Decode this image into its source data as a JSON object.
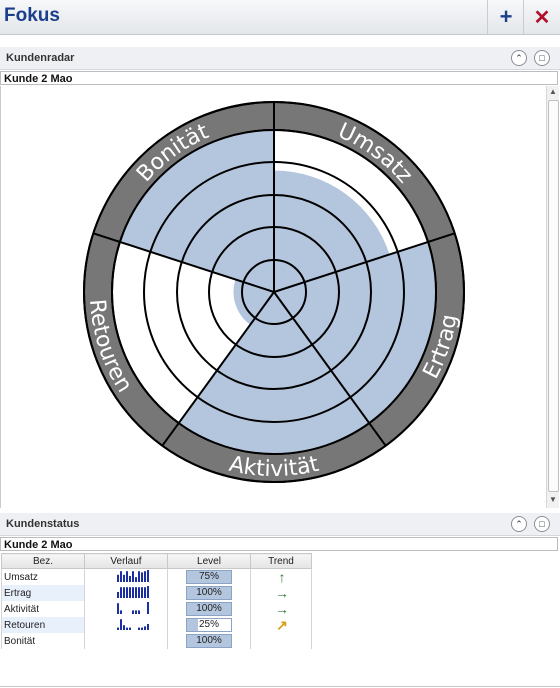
{
  "app": {
    "title": "Fokus",
    "add_label": "+",
    "close_label": "✕"
  },
  "radar_panel": {
    "title": "Kundenradar",
    "subject": "Kunde 2 Mao",
    "segments": [
      {
        "label": "Umsatz",
        "level": 0.75
      },
      {
        "label": "Ertrag",
        "level": 1.0
      },
      {
        "label": "Aktivität",
        "level": 1.0
      },
      {
        "label": "Retouren",
        "level": 0.25
      },
      {
        "label": "Bonität",
        "level": 1.0
      }
    ],
    "colors": {
      "fill": "#b4c6de",
      "ring": "#777777",
      "ring_text": "#ffffff"
    }
  },
  "status_panel": {
    "title": "Kundenstatus",
    "subject": "Kunde 2 Mao",
    "columns": [
      "Bez.",
      "Verlauf",
      "Level",
      "Trend"
    ],
    "rows": [
      {
        "name": "Umsatz",
        "level": "75%",
        "trend": "up",
        "trend_icon": "↑",
        "trend_color": "#2e7d32"
      },
      {
        "name": "Ertrag",
        "level": "100%",
        "trend": "right",
        "trend_icon": "→",
        "trend_color": "#2e7d32"
      },
      {
        "name": "Aktivität",
        "level": "100%",
        "trend": "right",
        "trend_icon": "→",
        "trend_color": "#2e7d32"
      },
      {
        "name": "Retouren",
        "level": "25%",
        "trend": "up-right",
        "trend_icon": "↗",
        "trend_color": "#d4a017"
      },
      {
        "name": "Bonität",
        "level": "100%",
        "trend": "none",
        "trend_icon": "",
        "trend_color": "#2e7d32"
      }
    ]
  }
}
